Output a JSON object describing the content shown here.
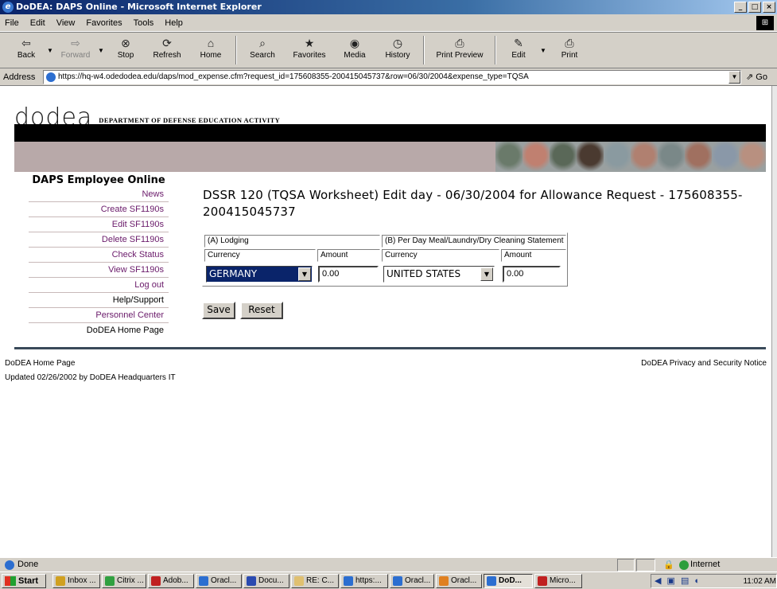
{
  "window": {
    "title": "DoDEA: DAPS Online - Microsoft Internet Explorer",
    "controls": [
      "_",
      "̅̅",
      "X"
    ]
  },
  "menu": {
    "items": [
      "File",
      "Edit",
      "View",
      "Favorites",
      "Tools",
      "Help"
    ]
  },
  "toolbar": {
    "back": "Back",
    "forward": "Forward",
    "stop": "Stop",
    "refresh": "Refresh",
    "home": "Home",
    "search": "Search",
    "favorites": "Favorites",
    "media": "Media",
    "history": "History",
    "print_preview": "Print Preview",
    "edit": "Edit",
    "print": "Print"
  },
  "address": {
    "label": "Address",
    "url": "https://hq-w4.odedodea.edu/daps/mod_expense.cfm?request_id=175608355-200415045737&row=06/30/2004&expense_type=TQSA",
    "go": "Go"
  },
  "header": {
    "logo_word": "dodea",
    "logo_sub": "DEPARTMENT OF DEFENSE EDUCATION ACTIVITY",
    "face_colors": [
      "#6a7a6a",
      "#c08070",
      "#5a6858",
      "#4a3a30",
      "#8a9aa0",
      "#b08070",
      "#7a8888",
      "#a07060",
      "#8a98a8",
      "#b89080"
    ]
  },
  "sidebar": {
    "title": "DAPS Employee Online",
    "items": [
      {
        "label": "News"
      },
      {
        "label": "Create SF1190s"
      },
      {
        "label": "Edit SF1190s"
      },
      {
        "label": "Delete SF1190s"
      },
      {
        "label": "Check Status"
      },
      {
        "label": "View SF1190s"
      },
      {
        "label": "Log out"
      },
      {
        "label": "Help/Support"
      },
      {
        "label": "Personnel Center"
      },
      {
        "label": "DoDEA Home Page"
      }
    ]
  },
  "main": {
    "title": "DSSR 120 (TQSA Worksheet) Edit day - 06/30/2004 for Allowance Request - 175608355-200415045737",
    "lodging": {
      "header": "(A) Lodging",
      "currency_label": "Currency",
      "amount_label": "Amount",
      "currency_value": "GERMANY",
      "amount_value": "0.00"
    },
    "per_day": {
      "header": "(B) Per Day Meal/Laundry/Dry Cleaning Statement",
      "currency_label": "Currency",
      "amount_label": "Amount",
      "currency_value": "UNITED STATES",
      "amount_value": "0.00"
    },
    "save_label": "Save",
    "reset_label": "Reset"
  },
  "footer": {
    "home": "DoDEA Home Page",
    "updated": "Updated 02/26/2002 by DoDEA Headquarters IT",
    "privacy": "DoDEA Privacy and Security Notice"
  },
  "status": {
    "text": "Done",
    "zone": "Internet"
  },
  "taskbar": {
    "start": "Start",
    "tasks": [
      {
        "label": "Inbox ...",
        "color": "#d0a020"
      },
      {
        "label": "Citrix ...",
        "color": "#30a040"
      },
      {
        "label": "Adob...",
        "color": "#c02020"
      },
      {
        "label": "Oracl...",
        "color": "#2c6ed0"
      },
      {
        "label": "Docu...",
        "color": "#2a4ab0"
      },
      {
        "label": "RE: C...",
        "color": "#e0c070"
      },
      {
        "label": "https:...",
        "color": "#2c6ed0"
      },
      {
        "label": "Oracl...",
        "color": "#2c6ed0"
      },
      {
        "label": "Oracl...",
        "color": "#e08020"
      },
      {
        "label": "DoD...",
        "color": "#2c6ed0"
      },
      {
        "label": "Micro...",
        "color": "#c02020"
      }
    ],
    "clock": "11:02 AM"
  }
}
